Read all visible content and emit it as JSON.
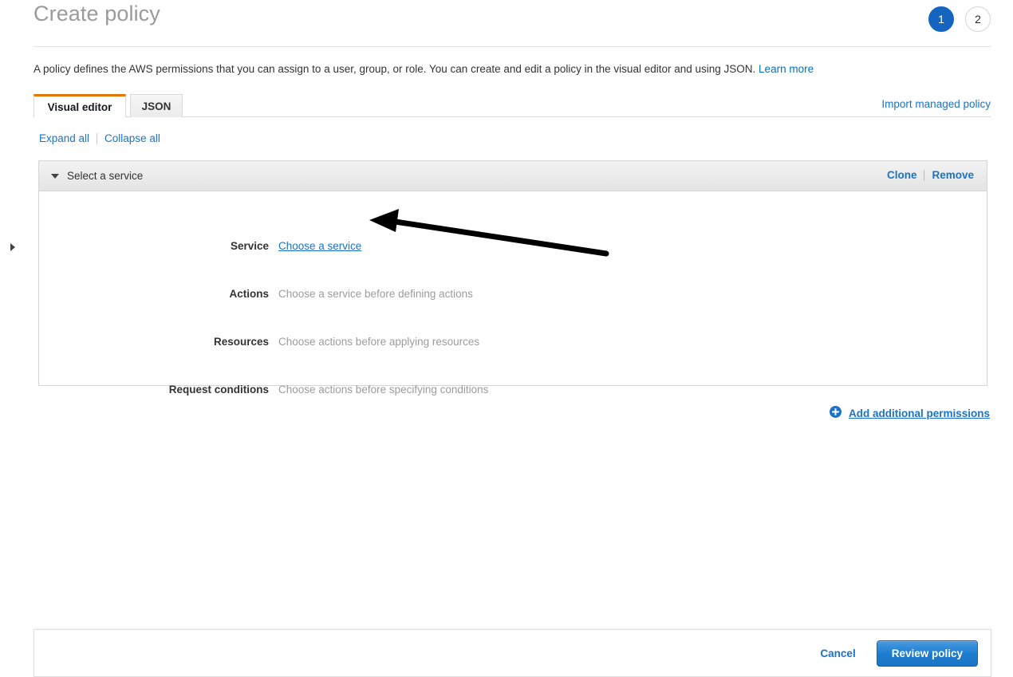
{
  "header": {
    "title": "Create policy",
    "steps": [
      {
        "label": "1",
        "state": "active"
      },
      {
        "label": "2",
        "state": "inactive"
      }
    ]
  },
  "description": {
    "text": "A policy defines the AWS permissions that you can assign to a user, group, or role. You can create and edit a policy in the visual editor and using JSON.",
    "learn_more": "Learn more"
  },
  "tabs": {
    "visual_editor": "Visual editor",
    "json": "JSON",
    "import_managed_policy": "Import managed policy",
    "active": "Visual editor"
  },
  "toolbar": {
    "expand_all": "Expand all",
    "collapse_all": "Collapse all"
  },
  "panel": {
    "header_title": "Select a service",
    "clone": "Clone",
    "remove": "Remove",
    "rows": [
      {
        "label": "Service",
        "value": "Choose a service",
        "is_link": true
      },
      {
        "label": "Actions",
        "value": "Choose a service before defining actions",
        "is_link": false
      },
      {
        "label": "Resources",
        "value": "Choose actions before applying resources",
        "is_link": false
      },
      {
        "label": "Request conditions",
        "value": "Choose actions before specifying conditions",
        "is_link": false
      }
    ]
  },
  "add_permissions": {
    "label": "Add additional permissions"
  },
  "footer": {
    "cancel": "Cancel",
    "review_policy": "Review policy"
  },
  "colors": {
    "accent_blue": "#1a73c8",
    "step_active": "#1565c0",
    "tab_active_border": "#e07700",
    "link": "#0073bb",
    "muted_text": "#9c9c9c"
  }
}
